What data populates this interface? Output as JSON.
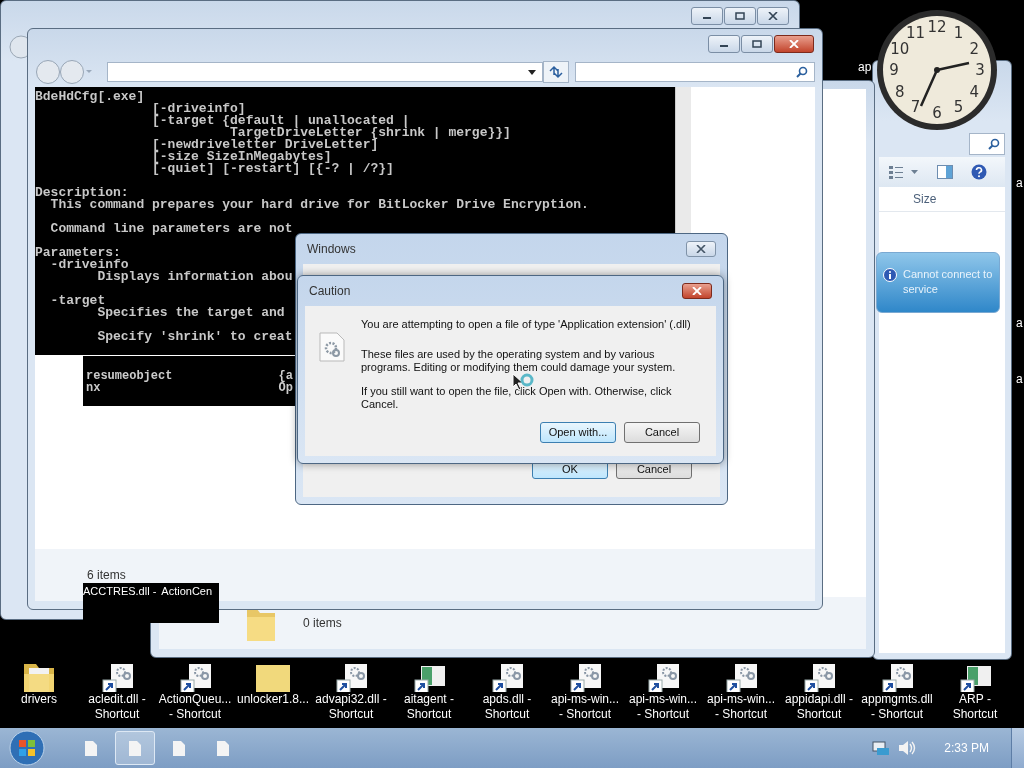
{
  "right_window": {
    "column_header": "Size"
  },
  "middle_window": {
    "status_bar": "0 items"
  },
  "console_window": {
    "console_blocks": [
      [
        "BdeHdCfg[.exe]",
        "               [-driveinfo]",
        "               [-target {default | unallocated |",
        "                         TargetDriveLetter {shrink | merge}}]",
        "               [-newdriveletter DriveLetter]",
        "               [-size SizeInMegabytes]",
        "               [-quiet] [-restart] [{-? | /?}]"
      ],
      [
        "Description:",
        "  This command prepares your hard drive for BitLocker Drive Encryption."
      ],
      [
        "  Command line parameters are not"
      ],
      [
        "Parameters:",
        "  -driveinfo",
        "        Displays information abou"
      ],
      [
        "  -target",
        "        Specifies the target and"
      ],
      [
        "        Specify 'shrink' to creat"
      ]
    ],
    "status_bar": "6 items"
  },
  "background_console": {
    "rows": [
      {
        "column_1": "resumeobject",
        "column_2": "{a"
      },
      {
        "column_1": "nx",
        "column_2": "Op"
      }
    ]
  },
  "desktop_fragments": {
    "labels": [
      "ACCTRES.dll -",
      "ActionCen"
    ],
    "right_edge": [
      "ap",
      "a",
      "a",
      "a"
    ]
  },
  "windows_dialog": {
    "title": "Windows",
    "buttons": [
      {
        "label": "OK",
        "default": true
      },
      {
        "label": "Cancel",
        "default": false
      }
    ]
  },
  "caution_dialog": {
    "title": "Caution",
    "message": "You are attempting to open a file of type 'Application extension' (.dll)",
    "details": "These files are used by the operating system and by various programs. Editing or modifying them could damage your system.",
    "instruction": "If you still want to open the file, click Open with. Otherwise, click Cancel.",
    "buttons": [
      {
        "label": "Open with...",
        "default": true
      },
      {
        "label": "Cancel",
        "default": false
      }
    ]
  },
  "clock_gadget": {
    "numerals": [
      "11",
      "12",
      "1",
      "10",
      "2",
      "9",
      "3",
      "8",
      "4",
      "7",
      "6",
      "5"
    ]
  },
  "notification": {
    "text": "Cannot connect to service"
  },
  "desktop_icons": [
    {
      "kind": "folder",
      "label": [
        "drivers"
      ]
    },
    {
      "kind": "dll",
      "label": [
        "acledit.dll -",
        "Shortcut"
      ]
    },
    {
      "kind": "dll",
      "label": [
        "ActionQueu...",
        "- Shortcut"
      ]
    },
    {
      "kind": "zip",
      "label": [
        "unlocker1.8..."
      ]
    },
    {
      "kind": "dll",
      "label": [
        "advapi32.dll -",
        "Shortcut"
      ]
    },
    {
      "kind": "app",
      "label": [
        "aitagent -",
        "Shortcut"
      ]
    },
    {
      "kind": "dll",
      "label": [
        "apds.dll -",
        "Shortcut"
      ]
    },
    {
      "kind": "dll",
      "label": [
        "api-ms-win...",
        "- Shortcut"
      ]
    },
    {
      "kind": "dll",
      "label": [
        "api-ms-win...",
        "- Shortcut"
      ]
    },
    {
      "kind": "dll",
      "label": [
        "api-ms-win...",
        "- Shortcut"
      ]
    },
    {
      "kind": "dll",
      "label": [
        "appidapi.dll -",
        "Shortcut"
      ]
    },
    {
      "kind": "dll",
      "label": [
        "appmgmts.dll",
        "- Shortcut"
      ]
    },
    {
      "kind": "app",
      "label": [
        "ARP -",
        "Shortcut"
      ]
    }
  ],
  "taskbar": {
    "buttons": [
      {
        "selected": false
      },
      {
        "selected": true
      },
      {
        "selected": false
      },
      {
        "selected": false
      }
    ],
    "clock": "2:33 PM"
  }
}
